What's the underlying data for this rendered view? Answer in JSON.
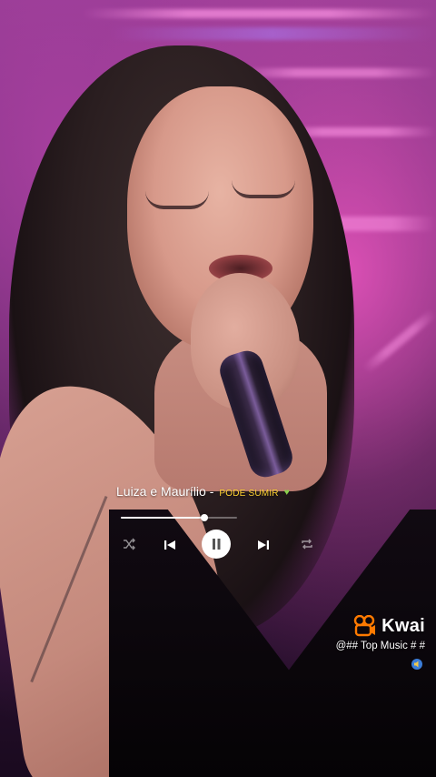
{
  "player": {
    "artist": "Luiza e Maurílio -",
    "song": "PODE SUMIR",
    "heart_icon": "green-heart-icon",
    "progress": 0.72,
    "state": "playing"
  },
  "controls": {
    "shuffle_icon": "shuffle-icon",
    "previous_icon": "skip-previous-icon",
    "pause_icon": "pause-icon",
    "next_icon": "skip-next-icon",
    "repeat_icon": "repeat-icon"
  },
  "watermark": {
    "brand": "Kwai",
    "handle": "@## Top Music # #",
    "accent": "#ff7a00"
  },
  "colors": {
    "song_title": "#ffd233",
    "heart": "#8ad24c",
    "background_pink": "#d94fb3"
  }
}
